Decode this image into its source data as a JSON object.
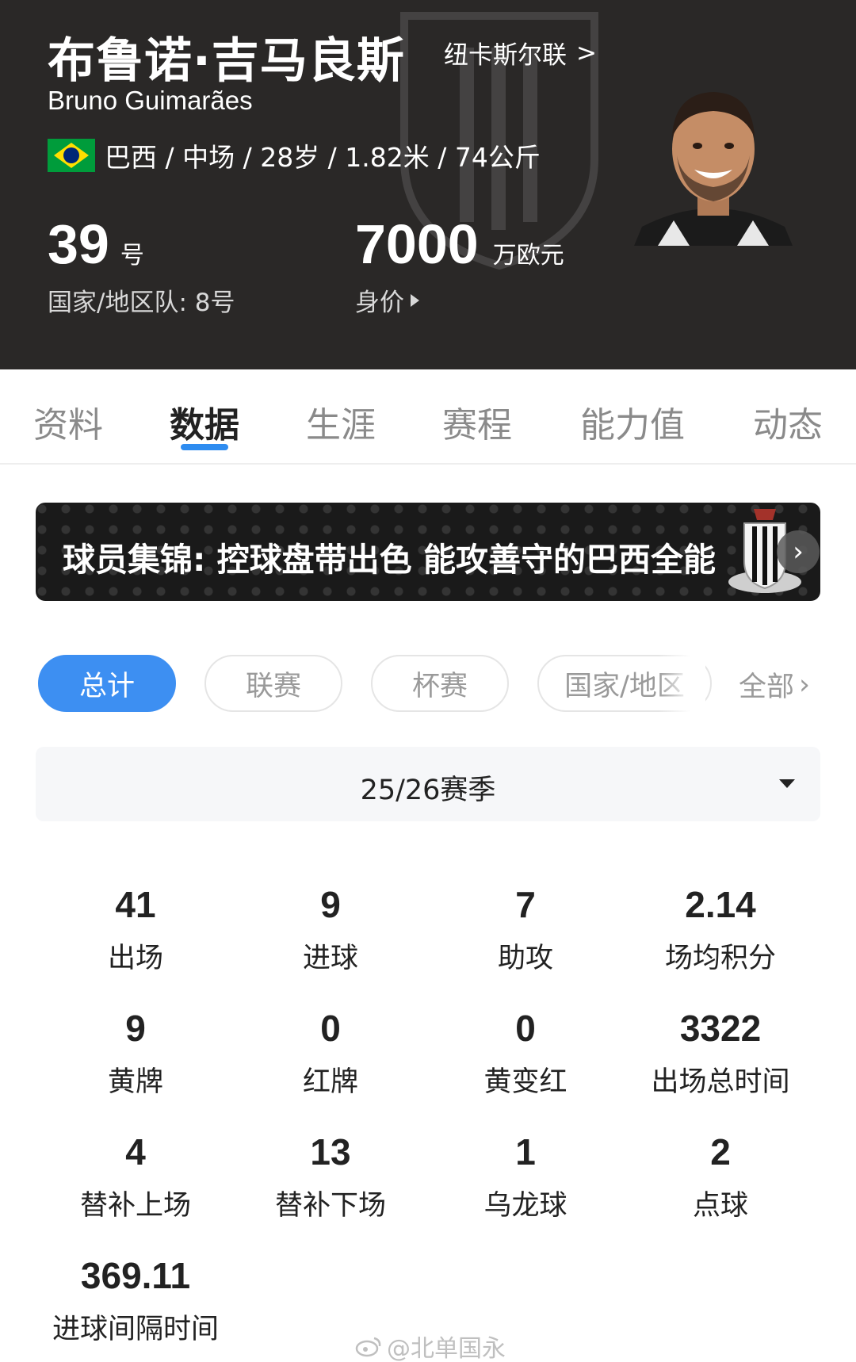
{
  "header": {
    "name_cn": "布鲁诺·吉马良斯",
    "club": "纽卡斯尔联",
    "club_arrow": ">",
    "name_en": "Bruno Guimarães",
    "info": "巴西 / 中场 / 28岁 / 1.82米 / 74公斤",
    "shirt_number": "39",
    "shirt_unit": "号",
    "national_team": "国家/地区队:  8号",
    "market_value": "7000",
    "market_value_unit": "万欧元",
    "market_value_label": "身价"
  },
  "tabs": [
    {
      "label": "资料"
    },
    {
      "label": "数据"
    },
    {
      "label": "生涯"
    },
    {
      "label": "赛程"
    },
    {
      "label": "能力值"
    },
    {
      "label": "动态"
    }
  ],
  "active_tab": "数据",
  "banner": {
    "text": "球员集锦:  控球盘带出色 能攻善守的巴西全能",
    "arrow": "›"
  },
  "filters": {
    "chips": [
      {
        "label": "总计"
      },
      {
        "label": "联赛"
      },
      {
        "label": "杯赛"
      },
      {
        "label": "国家/地区"
      }
    ],
    "active": "总计",
    "all_label": "全部",
    "all_arrow": "›"
  },
  "season": {
    "label": "25/26赛季"
  },
  "stats": [
    {
      "value": "41",
      "label": "出场"
    },
    {
      "value": "9",
      "label": "进球"
    },
    {
      "value": "7",
      "label": "助攻"
    },
    {
      "value": "2.14",
      "label": "场均积分"
    },
    {
      "value": "9",
      "label": "黄牌"
    },
    {
      "value": "0",
      "label": "红牌"
    },
    {
      "value": "0",
      "label": "黄变红"
    },
    {
      "value": "3322",
      "label": "出场总时间"
    },
    {
      "value": "4",
      "label": "替补上场"
    },
    {
      "value": "13",
      "label": "替补下场"
    },
    {
      "value": "1",
      "label": "乌龙球"
    },
    {
      "value": "2",
      "label": "点球"
    },
    {
      "value": "369.11",
      "label": "进球间隔时间"
    }
  ],
  "watermark": "@北单国永",
  "colors": {
    "header_bg": "#2a2827",
    "accent": "#3d8ff2",
    "tab_underline": "#2e8cf0"
  }
}
